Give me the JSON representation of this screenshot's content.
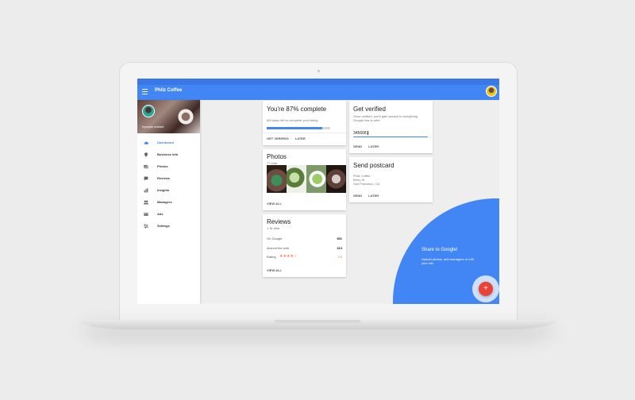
{
  "app": {
    "title": "Philz Coffee"
  },
  "sidebar": {
    "handle": "hyeeple.market",
    "items": [
      {
        "label": "Dashboard",
        "icon": "cloud-icon",
        "active": true
      },
      {
        "label": "Business info",
        "icon": "location-pin-icon"
      },
      {
        "label": "Photos",
        "icon": "photos-icon"
      },
      {
        "label": "Reviews",
        "icon": "reviews-icon"
      },
      {
        "label": "Insights",
        "icon": "bar-chart-icon"
      },
      {
        "label": "Managers",
        "icon": "people-icon"
      },
      {
        "label": "Ads",
        "icon": "ads-icon"
      },
      {
        "label": "Settings",
        "icon": "sliders-icon"
      }
    ]
  },
  "progress_card": {
    "title": "You're 87% complete",
    "subtitle": "6/8 tasks left to complete your listing",
    "progress": 0.87,
    "actions": [
      "GET VERIFIED",
      "LATER"
    ]
  },
  "photos_card": {
    "title": "Photos",
    "subtitle": "77 total",
    "action": "VIEW ALL"
  },
  "reviews_card": {
    "title": "Reviews",
    "subtitle": "1.3k total",
    "rows": [
      {
        "label": "On Google",
        "value": "951"
      },
      {
        "label": "Around the web",
        "value": "313"
      },
      {
        "label": "Rating",
        "value": "3.5",
        "stars": "★★★★☆"
      }
    ],
    "action": "VIEW ALL"
  },
  "verify_card": {
    "title": "Get verified",
    "subtitle": "Once verified, you'll gain access to everything Google has to offer",
    "input_value": "345668",
    "actions": [
      "SEND",
      "LATER"
    ]
  },
  "postcard_card": {
    "title": "Send postcard",
    "address": [
      "Philz Coffee",
      "Berry St",
      "San Francisco, CA"
    ],
    "actions": [
      "SEND",
      "LATER"
    ]
  },
  "share": {
    "title": "Share to Google!",
    "text": "Upload photos, add managers or edit your info",
    "fab_label": "+"
  },
  "colors": {
    "primary": "#4285f4",
    "fab": "#ea4335",
    "star": "#ff7043"
  }
}
